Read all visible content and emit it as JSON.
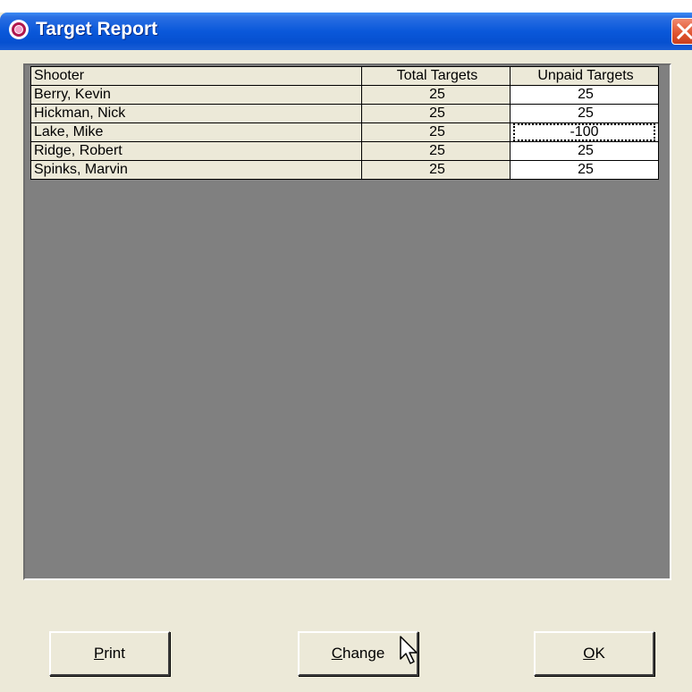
{
  "window": {
    "title": "Target Report"
  },
  "table": {
    "headers": [
      "Shooter",
      "Total Targets",
      "Unpaid Targets"
    ],
    "rows": [
      {
        "shooter": "Berry, Kevin",
        "total": "25",
        "unpaid": "25"
      },
      {
        "shooter": "Hickman, Nick",
        "total": "25",
        "unpaid": "25"
      },
      {
        "shooter": "Lake, Mike",
        "total": "25",
        "unpaid": "-100"
      },
      {
        "shooter": "Ridge, Robert",
        "total": "25",
        "unpaid": "25"
      },
      {
        "shooter": "Spinks, Marvin",
        "total": "25",
        "unpaid": "25"
      }
    ]
  },
  "buttons": {
    "print": {
      "accel": "P",
      "rest": "rint"
    },
    "change": {
      "accel": "C",
      "rest": "hange"
    },
    "ok": {
      "accel": "O",
      "rest": "K"
    }
  },
  "colors": {
    "titlebar": "#0a58da",
    "window_bg": "#ece9d8",
    "grid_bg": "#808080",
    "close_button": "#e0532e"
  },
  "icons": {
    "title": "app-target-icon",
    "close": "close-icon",
    "cursor": "mouse-pointer-icon"
  }
}
